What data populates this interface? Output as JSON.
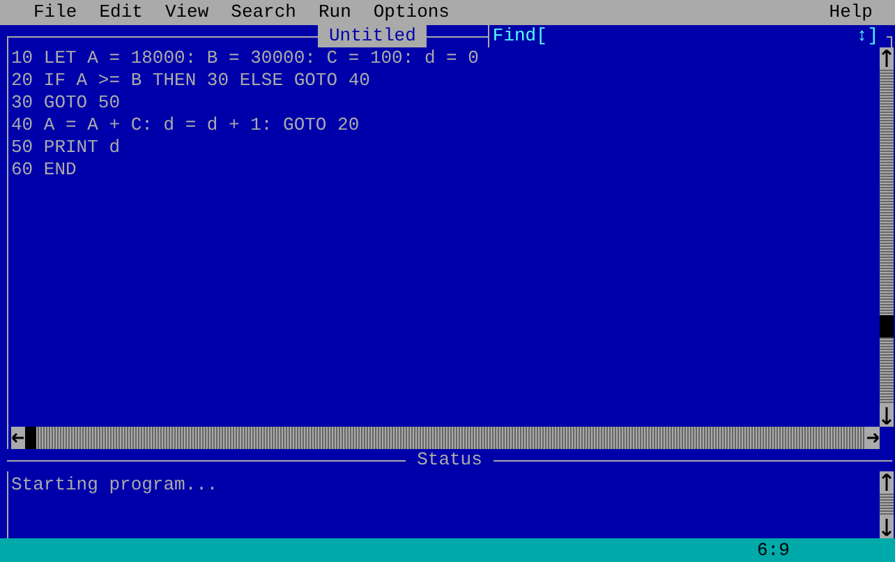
{
  "menu_bar": {
    "items": [
      {
        "label": "File"
      },
      {
        "label": "Edit"
      },
      {
        "label": "View"
      },
      {
        "label": "Search"
      },
      {
        "label": "Run"
      },
      {
        "label": "Options"
      }
    ],
    "help": "Help"
  },
  "editor": {
    "title": "Untitled",
    "find_label": "Find[",
    "find_end": "↕]",
    "lines": [
      "10 LET A = 18000: B = 30000: C = 100: d = 0",
      "20 IF A >= B THEN 30 ELSE GOTO 40",
      "30 GOTO 50",
      "40 A = A + C: d = d + 1: GOTO 20",
      "50 PRINT d",
      "60 END"
    ]
  },
  "status_window": {
    "title": "Status",
    "text": "Starting program..."
  },
  "status_bar": {
    "position": "6:9"
  }
}
